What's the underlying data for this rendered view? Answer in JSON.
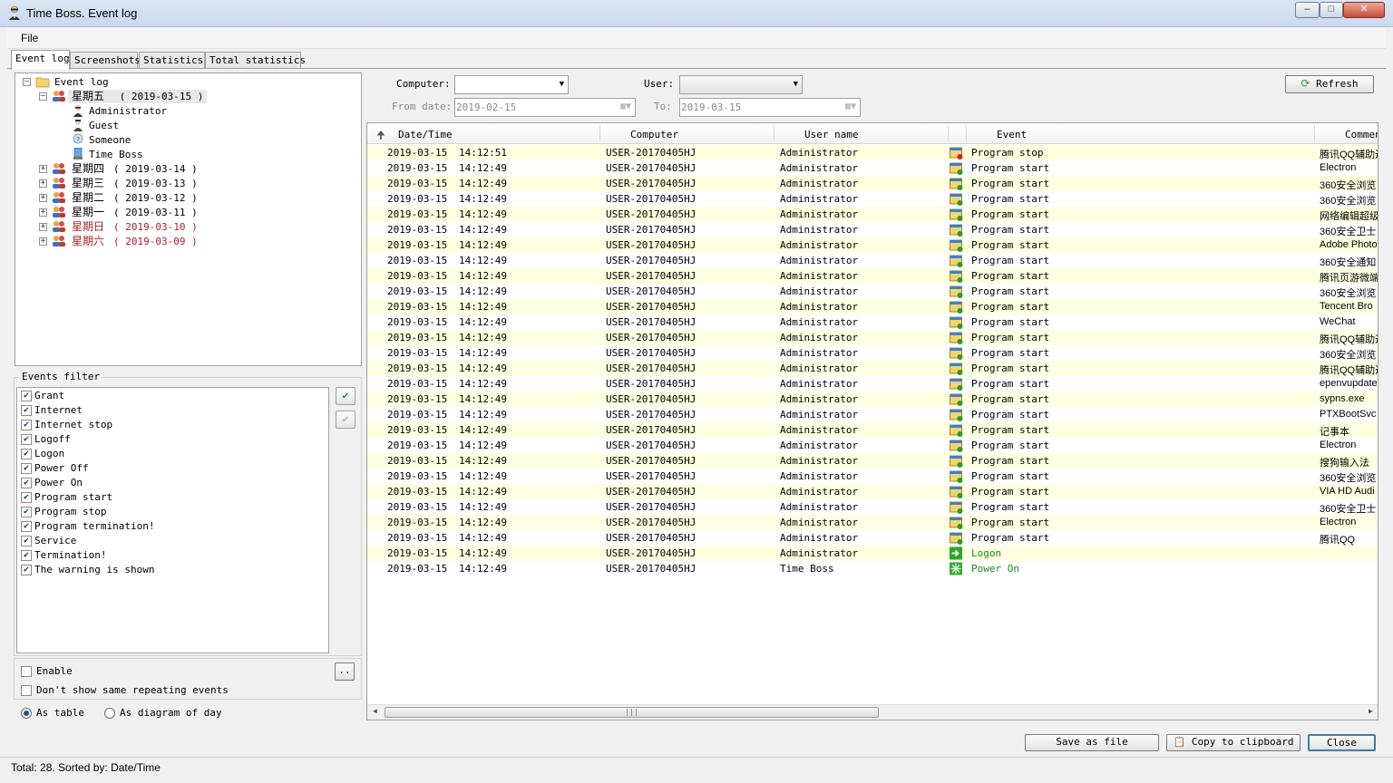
{
  "window": {
    "title": "Time Boss. Event log"
  },
  "menu": {
    "file": "File"
  },
  "tabs": [
    {
      "label": "Event log",
      "active": true
    },
    {
      "label": "Screenshots",
      "active": false
    },
    {
      "label": "Statistics",
      "active": false
    },
    {
      "label": "Total statistics",
      "active": false
    }
  ],
  "tree": {
    "root": "Event log",
    "expanded_day": {
      "label": "星期五",
      "date": "( 2019-03-15 )"
    },
    "users": [
      "Administrator",
      "Guest",
      "Someone",
      "Time Boss"
    ],
    "days": [
      {
        "label": "星期四",
        "date": "( 2019-03-14 )",
        "weekend": false
      },
      {
        "label": "星期三",
        "date": "( 2019-03-13 )",
        "weekend": false
      },
      {
        "label": "星期二",
        "date": "( 2019-03-12 )",
        "weekend": false
      },
      {
        "label": "星期一",
        "date": "( 2019-03-11 )",
        "weekend": false
      },
      {
        "label": "星期日",
        "date": "( 2019-03-10 )",
        "weekend": true
      },
      {
        "label": "星期六",
        "date": "( 2019-03-09 )",
        "weekend": true
      }
    ]
  },
  "filter": {
    "title": "Events filter",
    "items": [
      {
        "label": "Grant",
        "checked": true
      },
      {
        "label": "Internet",
        "checked": true
      },
      {
        "label": "Internet stop",
        "checked": true
      },
      {
        "label": "Logoff",
        "checked": true
      },
      {
        "label": "Logon",
        "checked": true
      },
      {
        "label": "Power Off",
        "checked": true
      },
      {
        "label": "Power On",
        "checked": true
      },
      {
        "label": "Program start",
        "checked": true
      },
      {
        "label": "Program stop",
        "checked": true
      },
      {
        "label": "Program termination!",
        "checked": true
      },
      {
        "label": "Service",
        "checked": true
      },
      {
        "label": "Termination!",
        "checked": true
      },
      {
        "label": "The warning is shown",
        "checked": true
      }
    ],
    "enable_label": "Enable",
    "dont_show_label": "Don't show same repeating events",
    "as_table_label": "As table",
    "as_diagram_label": "As diagram of day"
  },
  "criteria": {
    "computer_label": "Computer:",
    "user_label": "User:",
    "from_label": "From date:",
    "from_value": "2019-02-15",
    "to_label": "To:",
    "to_value": "2019-03-15",
    "refresh_label": "Refresh"
  },
  "table": {
    "columns": [
      "Date/Time",
      "Computer",
      "User name",
      "Event",
      "Commen"
    ],
    "rows": [
      {
        "date": "2019-03-15",
        "time": "14:12:51",
        "computer": "USER-20170405HJ",
        "user": "Administrator",
        "event": "Program stop",
        "comment": "腾讯QQ辅助进",
        "kind": "stop"
      },
      {
        "date": "2019-03-15",
        "time": "14:12:49",
        "computer": "USER-20170405HJ",
        "user": "Administrator",
        "event": "Program start",
        "comment": "Electron",
        "kind": "start"
      },
      {
        "date": "2019-03-15",
        "time": "14:12:49",
        "computer": "USER-20170405HJ",
        "user": "Administrator",
        "event": "Program start",
        "comment": "360安全浏览",
        "kind": "start"
      },
      {
        "date": "2019-03-15",
        "time": "14:12:49",
        "computer": "USER-20170405HJ",
        "user": "Administrator",
        "event": "Program start",
        "comment": "360安全浏览",
        "kind": "start"
      },
      {
        "date": "2019-03-15",
        "time": "14:12:49",
        "computer": "USER-20170405HJ",
        "user": "Administrator",
        "event": "Program start",
        "comment": "网络编辑超级",
        "kind": "start"
      },
      {
        "date": "2019-03-15",
        "time": "14:12:49",
        "computer": "USER-20170405HJ",
        "user": "Administrator",
        "event": "Program start",
        "comment": "360安全卫士",
        "kind": "start"
      },
      {
        "date": "2019-03-15",
        "time": "14:12:49",
        "computer": "USER-20170405HJ",
        "user": "Administrator",
        "event": "Program start",
        "comment": "Adobe Photo",
        "kind": "start"
      },
      {
        "date": "2019-03-15",
        "time": "14:12:49",
        "computer": "USER-20170405HJ",
        "user": "Administrator",
        "event": "Program start",
        "comment": "360安全通知",
        "kind": "start"
      },
      {
        "date": "2019-03-15",
        "time": "14:12:49",
        "computer": "USER-20170405HJ",
        "user": "Administrator",
        "event": "Program start",
        "comment": "腾讯页游微端",
        "kind": "start"
      },
      {
        "date": "2019-03-15",
        "time": "14:12:49",
        "computer": "USER-20170405HJ",
        "user": "Administrator",
        "event": "Program start",
        "comment": "360安全浏览",
        "kind": "start"
      },
      {
        "date": "2019-03-15",
        "time": "14:12:49",
        "computer": "USER-20170405HJ",
        "user": "Administrator",
        "event": "Program start",
        "comment": "Tencent Bro",
        "kind": "start"
      },
      {
        "date": "2019-03-15",
        "time": "14:12:49",
        "computer": "USER-20170405HJ",
        "user": "Administrator",
        "event": "Program start",
        "comment": "WeChat",
        "kind": "start"
      },
      {
        "date": "2019-03-15",
        "time": "14:12:49",
        "computer": "USER-20170405HJ",
        "user": "Administrator",
        "event": "Program start",
        "comment": "腾讯QQ辅助进",
        "kind": "start"
      },
      {
        "date": "2019-03-15",
        "time": "14:12:49",
        "computer": "USER-20170405HJ",
        "user": "Administrator",
        "event": "Program start",
        "comment": "360安全浏览",
        "kind": "start"
      },
      {
        "date": "2019-03-15",
        "time": "14:12:49",
        "computer": "USER-20170405HJ",
        "user": "Administrator",
        "event": "Program start",
        "comment": "腾讯QQ辅助进",
        "kind": "start"
      },
      {
        "date": "2019-03-15",
        "time": "14:12:49",
        "computer": "USER-20170405HJ",
        "user": "Administrator",
        "event": "Program start",
        "comment": "epenvupdate",
        "kind": "start"
      },
      {
        "date": "2019-03-15",
        "time": "14:12:49",
        "computer": "USER-20170405HJ",
        "user": "Administrator",
        "event": "Program start",
        "comment": "sypns.exe",
        "kind": "start"
      },
      {
        "date": "2019-03-15",
        "time": "14:12:49",
        "computer": "USER-20170405HJ",
        "user": "Administrator",
        "event": "Program start",
        "comment": "PTXBootSvc",
        "kind": "start"
      },
      {
        "date": "2019-03-15",
        "time": "14:12:49",
        "computer": "USER-20170405HJ",
        "user": "Administrator",
        "event": "Program start",
        "comment": "记事本",
        "kind": "start"
      },
      {
        "date": "2019-03-15",
        "time": "14:12:49",
        "computer": "USER-20170405HJ",
        "user": "Administrator",
        "event": "Program start",
        "comment": "Electron",
        "kind": "start"
      },
      {
        "date": "2019-03-15",
        "time": "14:12:49",
        "computer": "USER-20170405HJ",
        "user": "Administrator",
        "event": "Program start",
        "comment": "搜狗输入法",
        "kind": "start"
      },
      {
        "date": "2019-03-15",
        "time": "14:12:49",
        "computer": "USER-20170405HJ",
        "user": "Administrator",
        "event": "Program start",
        "comment": "360安全浏览",
        "kind": "start"
      },
      {
        "date": "2019-03-15",
        "time": "14:12:49",
        "computer": "USER-20170405HJ",
        "user": "Administrator",
        "event": "Program start",
        "comment": "VIA HD Audi",
        "kind": "start"
      },
      {
        "date": "2019-03-15",
        "time": "14:12:49",
        "computer": "USER-20170405HJ",
        "user": "Administrator",
        "event": "Program start",
        "comment": "360安全卫士",
        "kind": "start"
      },
      {
        "date": "2019-03-15",
        "time": "14:12:49",
        "computer": "USER-20170405HJ",
        "user": "Administrator",
        "event": "Program start",
        "comment": "Electron",
        "kind": "start"
      },
      {
        "date": "2019-03-15",
        "time": "14:12:49",
        "computer": "USER-20170405HJ",
        "user": "Administrator",
        "event": "Program start",
        "comment": "腾讯QQ",
        "kind": "start"
      },
      {
        "date": "2019-03-15",
        "time": "14:12:49",
        "computer": "USER-20170405HJ",
        "user": "Administrator",
        "event": "Logon",
        "comment": "",
        "kind": "logon"
      },
      {
        "date": "2019-03-15",
        "time": "14:12:49",
        "computer": "USER-20170405HJ",
        "user": "Time Boss",
        "event": "Power On",
        "comment": "",
        "kind": "power"
      }
    ]
  },
  "buttons": {
    "save": "Save as file",
    "copy": "Copy to clipboard",
    "close": "Close",
    "filter_dots": ".."
  },
  "status": {
    "text": "Total: 28.  Sorted by: Date/Time"
  },
  "colors": {
    "row_alt": "#ffffe1",
    "green_event": "#1a8a1a",
    "weekend": "#b01e1e"
  }
}
